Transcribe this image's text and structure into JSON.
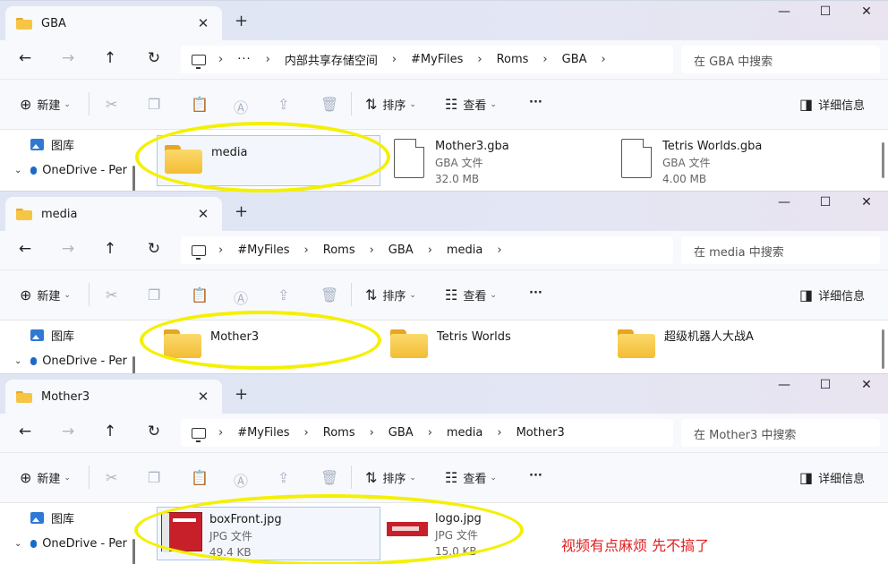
{
  "common": {
    "new_label": "新建",
    "sort_label": "排序",
    "view_label": "查看",
    "details_label": "详细信息",
    "more_label": "···",
    "sidebar_gallery": "图库",
    "sidebar_onedrive": "OneDrive - Per"
  },
  "windows": [
    {
      "tab_title": "GBA",
      "breadcrumb": [
        "···",
        "内部共享存储空间",
        "#MyFiles",
        "Roms",
        "GBA"
      ],
      "search_placeholder": "在 GBA 中搜索",
      "items": [
        {
          "name": "media",
          "kind": "folder"
        },
        {
          "name": "Mother3.gba",
          "type": "GBA 文件",
          "size": "32.0 MB",
          "kind": "file"
        },
        {
          "name": "Tetris Worlds.gba",
          "type": "GBA 文件",
          "size": "4.00 MB",
          "kind": "file"
        }
      ]
    },
    {
      "tab_title": "media",
      "breadcrumb": [
        "#MyFiles",
        "Roms",
        "GBA",
        "media"
      ],
      "search_placeholder": "在 media 中搜索",
      "items": [
        {
          "name": "Mother3",
          "kind": "folder"
        },
        {
          "name": "Tetris Worlds",
          "kind": "folder"
        },
        {
          "name": "超级机器人大战A",
          "kind": "folder"
        }
      ]
    },
    {
      "tab_title": "Mother3",
      "breadcrumb": [
        "#MyFiles",
        "Roms",
        "GBA",
        "media",
        "Mother3"
      ],
      "search_placeholder": "在 Mother3 中搜索",
      "items": [
        {
          "name": "boxFront.jpg",
          "type": "JPG 文件",
          "size": "49.4 KB",
          "kind": "image"
        },
        {
          "name": "logo.jpg",
          "type": "JPG 文件",
          "size": "15.0 KB",
          "kind": "image"
        }
      ]
    }
  ],
  "annotation_note": "视频有点麻烦 先不搞了",
  "colors": {
    "highlight": "#f4f000",
    "note": "#e02020"
  }
}
